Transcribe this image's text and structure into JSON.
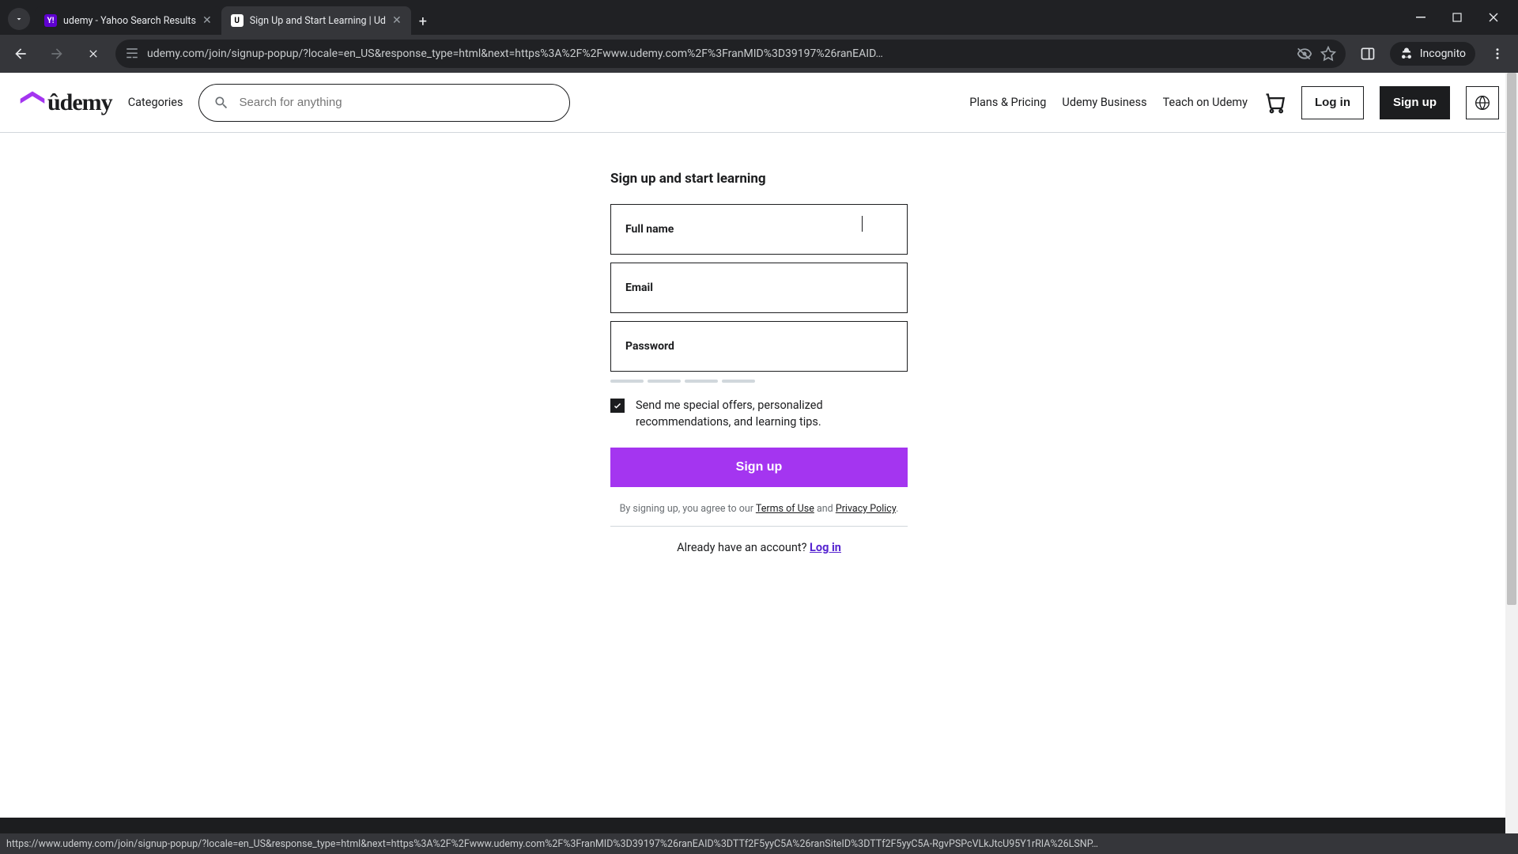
{
  "browser": {
    "tabs": [
      {
        "title": "udemy - Yahoo Search Results",
        "favicon_letter": "Y!",
        "active": false
      },
      {
        "title": "Sign Up and Start Learning | Ud",
        "favicon_letter": "U",
        "active": true
      }
    ],
    "url": "udemy.com/join/signup-popup/?locale=en_US&response_type=html&next=https%3A%2F%2Fwww.udemy.com%2F%3FranMID%3D39197%26ranEAID…",
    "incognito_label": "Incognito",
    "status_url": "https://www.udemy.com/join/signup-popup/?locale=en_US&response_type=html&next=https%3A%2F%2Fwww.udemy.com%2F%3FranMID%3D39197%26ranEAID%3DTTf2F5yyC5A%26ranSiteID%3DTTf2F5yyC5A-RgvPSPcVLkJtcU95Y1rRIA%26LSNP…"
  },
  "header": {
    "logo_text": "ûdemy",
    "categories": "Categories",
    "search_placeholder": "Search for anything",
    "links": {
      "plans": "Plans & Pricing",
      "business": "Udemy Business",
      "teach": "Teach on Udemy"
    },
    "login": "Log in",
    "signup": "Sign up"
  },
  "form": {
    "title": "Sign up and start learning",
    "fullname_label": "Full name",
    "email_label": "Email",
    "password_label": "Password",
    "offers_label": "Send me special offers, personalized recommendations, and learning tips.",
    "offers_checked": true,
    "submit": "Sign up",
    "terms_prefix": "By signing up, you agree to our ",
    "terms_link": "Terms of Use",
    "terms_and": " and ",
    "privacy_link": "Privacy Policy",
    "terms_suffix": ".",
    "already_prefix": "Already have an account? ",
    "login_link": "Log in"
  },
  "colors": {
    "accent": "#a435f0",
    "link": "#5624d0"
  }
}
